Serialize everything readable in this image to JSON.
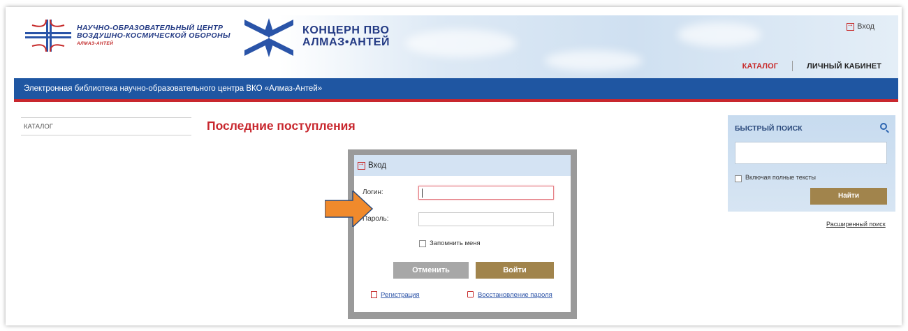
{
  "header": {
    "org_line1": "НАУЧНО-ОБРАЗОВАТЕЛЬНЫЙ ЦЕНТР",
    "org_line2": "ВОЗДУШНО-КОСМИЧЕСКОЙ ОБОРОНЫ",
    "org_line3": "АЛМАЗ-АНТЕЙ",
    "concern_line1": "КОНЦЕРН ПВО",
    "concern_line2": "АЛМАЗ•АНТЕЙ",
    "login_link": "Вход",
    "nav_catalog": "КАТАЛОГ",
    "nav_cabinet": "ЛИЧНЫЙ КАБИНЕТ",
    "banner": "Электронная библиотека научно-образовательного центра ВКО «Алмаз-Антей»"
  },
  "sidebar": {
    "catalog_label": "КАТАЛОГ"
  },
  "main": {
    "title": "Последние поступления"
  },
  "login_modal": {
    "title": "Вход",
    "login_label": "Логин:",
    "login_value": "",
    "password_label": "Пароль:",
    "password_value": "",
    "remember_label": "Запомнить меня",
    "cancel_button": "Отменить",
    "enter_button": "Войти",
    "register_link": "Регистрация",
    "restore_link": "Восстановление пароля"
  },
  "quick_search": {
    "title": "БЫСТРЫЙ ПОИСК",
    "input_value": "",
    "fulltext_label": "Включая полные тексты",
    "find_button": "Найти",
    "advanced_link": "Расширенный поиск"
  },
  "colors": {
    "brand_blue": "#1f56a2",
    "accent_red": "#c8272e",
    "button_gold": "#a1844c",
    "annotation_arrow": "#f08a2c"
  }
}
